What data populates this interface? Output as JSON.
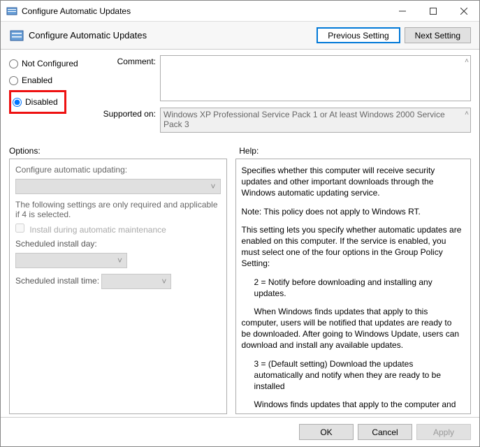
{
  "window": {
    "title": "Configure Automatic Updates"
  },
  "header": {
    "title": "Configure Automatic Updates",
    "prev": "Previous Setting",
    "next": "Next Setting"
  },
  "radios": {
    "not_configured": "Not Configured",
    "enabled": "Enabled",
    "disabled": "Disabled",
    "selected": "disabled"
  },
  "labels": {
    "comment": "Comment:",
    "supported": "Supported on:",
    "options": "Options:",
    "help": "Help:"
  },
  "supported_text": "Windows XP Professional Service Pack 1 or At least Windows 2000 Service Pack 3",
  "options": {
    "heading": "Configure automatic updating:",
    "note": "The following settings are only required and applicable if 4 is selected.",
    "check_label": "Install during automatic maintenance",
    "day_label": "Scheduled install day:",
    "time_label": "Scheduled install time:"
  },
  "help": {
    "p1": "Specifies whether this computer will receive security updates and other important downloads through the Windows automatic updating service.",
    "p2": "Note: This policy does not apply to Windows RT.",
    "p3": "This setting lets you specify whether automatic updates are enabled on this computer. If the service is enabled, you must select one of the four options in the Group Policy Setting:",
    "p4": "2 = Notify before downloading and installing any updates.",
    "p5": "When Windows finds updates that apply to this computer, users will be notified that updates are ready to be downloaded. After going to Windows Update, users can download and install any available updates.",
    "p6": "3 = (Default setting) Download the updates automatically and notify when they are ready to be installed",
    "p7": "Windows finds updates that apply to the computer and"
  },
  "footer": {
    "ok": "OK",
    "cancel": "Cancel",
    "apply": "Apply"
  }
}
